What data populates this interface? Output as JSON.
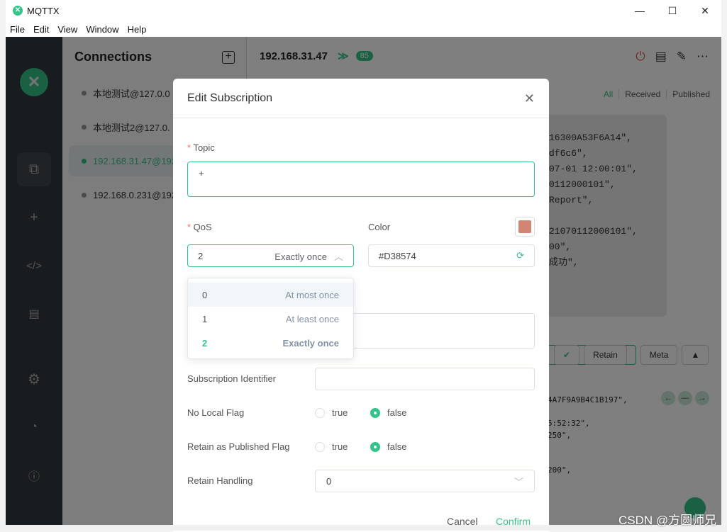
{
  "window": {
    "title": "MQTTX",
    "minimize": "—",
    "maximize": "☐",
    "close": "✕"
  },
  "menu": [
    "File",
    "Edit",
    "View",
    "Window",
    "Help"
  ],
  "connections": {
    "title": "Connections",
    "items": [
      {
        "label": "本地测试@127.0.0",
        "active": false
      },
      {
        "label": "本地测试2@127.0.",
        "active": false
      },
      {
        "label": "192.168.31.47@192",
        "active": true
      },
      {
        "label": "192.168.0.231@192",
        "active": false
      }
    ]
  },
  "main": {
    "title": "192.168.31.47",
    "badge": "85",
    "filters": [
      "All",
      "Received",
      "Published"
    ],
    "message_lines": [
      "16300A53F6A14\",",
      "df6c6\",",
      "07-01 12:00:01\",",
      "0112000101\",",
      "Report\",",
      "",
      "21070112000101\",",
      "00\",",
      "成功\","
    ],
    "message2_lines": [
      "4A7F9A9B4C1B197\",",
      "",
      "5:52:32\",",
      "250\",",
      "",
      "",
      "200\","
    ],
    "publish": {
      "retain": "Retain",
      "meta": "Meta",
      "expand": "▲"
    }
  },
  "dialog": {
    "title": "Edit Subscription",
    "topic_label": "Topic",
    "topic_value": "+",
    "qos_label": "QoS",
    "qos_value": "2",
    "qos_desc": "Exactly once",
    "color_label": "Color",
    "color_value": "#D38574",
    "qos_options": [
      {
        "value": "0",
        "desc": "At most once"
      },
      {
        "value": "1",
        "desc": "At least once"
      },
      {
        "value": "2",
        "desc": "Exactly once"
      }
    ],
    "sub_id_label": "Subscription Identifier",
    "sub_id_value": "",
    "no_local_label": "No Local Flag",
    "rap_label": "Retain as Published Flag",
    "true_label": "true",
    "false_label": "false",
    "no_local": "false",
    "rap": "false",
    "retain_handling_label": "Retain Handling",
    "retain_handling_value": "0",
    "cancel": "Cancel",
    "confirm": "Confirm"
  },
  "colors": {
    "accent": "#34C388",
    "subscription": "#D38574"
  },
  "watermark": "CSDN @方圆师兄"
}
